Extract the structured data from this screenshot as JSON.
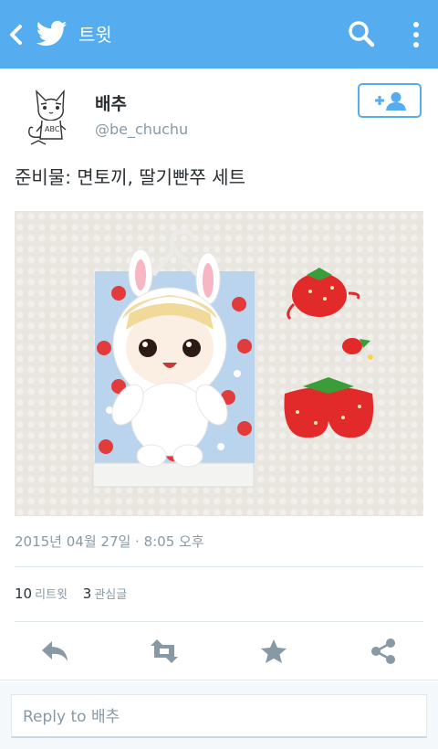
{
  "topbar": {
    "title": "트윗",
    "bg_color": "#55acee",
    "icons": [
      "back-icon",
      "twitter-bird-icon",
      "search-icon",
      "more-vertical-icon"
    ]
  },
  "author": {
    "name": "배추",
    "handle": "@be_chuchu"
  },
  "follow_button": {
    "icon": "add-user-icon",
    "color": "#55acee"
  },
  "tweet": {
    "text": "준비물: 면토끼, 딸기빤쭈 세트"
  },
  "timestamp": "2015년 04월 27일 · 8:05 오후",
  "stats": [
    {
      "count": "10",
      "label": "리트윗"
    },
    {
      "count": "3",
      "label": "관심글"
    }
  ],
  "actions": [
    "reply-icon",
    "retweet-icon",
    "favorite-icon",
    "share-icon"
  ],
  "reply": {
    "placeholder": "Reply to 배추"
  }
}
